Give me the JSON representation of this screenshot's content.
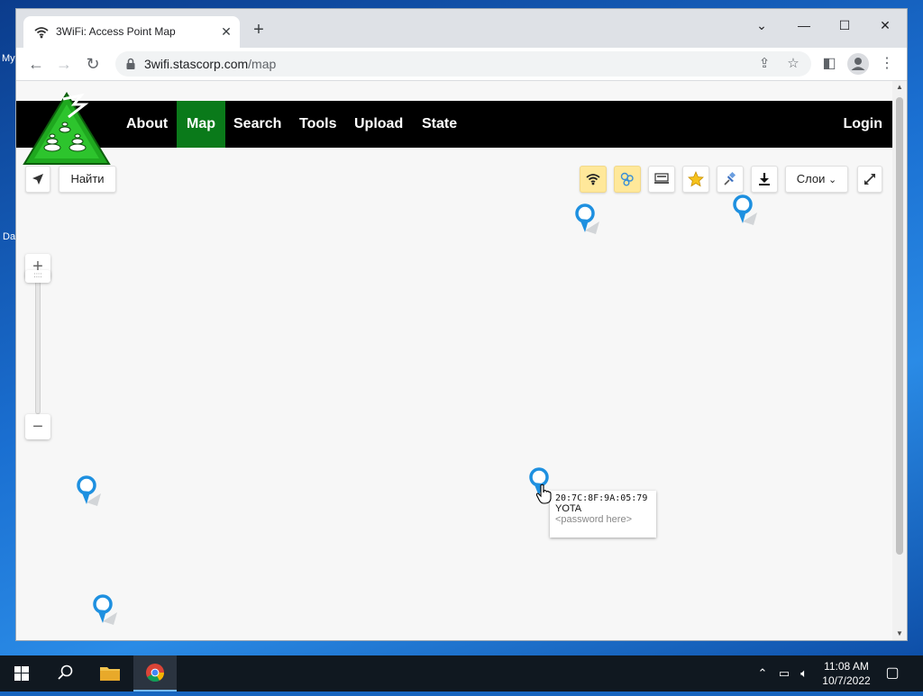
{
  "desktop": {
    "icon_labels": [
      "My",
      "Da"
    ]
  },
  "browser": {
    "tab_title": "3WiFi: Access Point Map",
    "url_host": "3wifi.stascorp.com",
    "url_path": "/map"
  },
  "site": {
    "nav": [
      "About",
      "Map",
      "Search",
      "Tools",
      "Upload",
      "State"
    ],
    "active_nav": "Map",
    "login": "Login",
    "logo_colors": {
      "triangle": "#1fa81f",
      "bg": "#000000"
    }
  },
  "map": {
    "find_button": "Найти",
    "layers_button": "Слои",
    "tool_icons": [
      "wifi-icon",
      "bubbles-icon",
      "network-card-icon",
      "star-icon",
      "pin-icon",
      "download-icon"
    ],
    "zoom": {
      "plus": "+",
      "minus": "−"
    },
    "tooltip": {
      "bssid": "20:7C:8F:9A:05:79",
      "ssid": "YOTA",
      "password": "<password here>"
    },
    "pin_color": "#1e90e0"
  },
  "taskbar": {
    "time": "11:08 AM",
    "date": "10/7/2022"
  }
}
